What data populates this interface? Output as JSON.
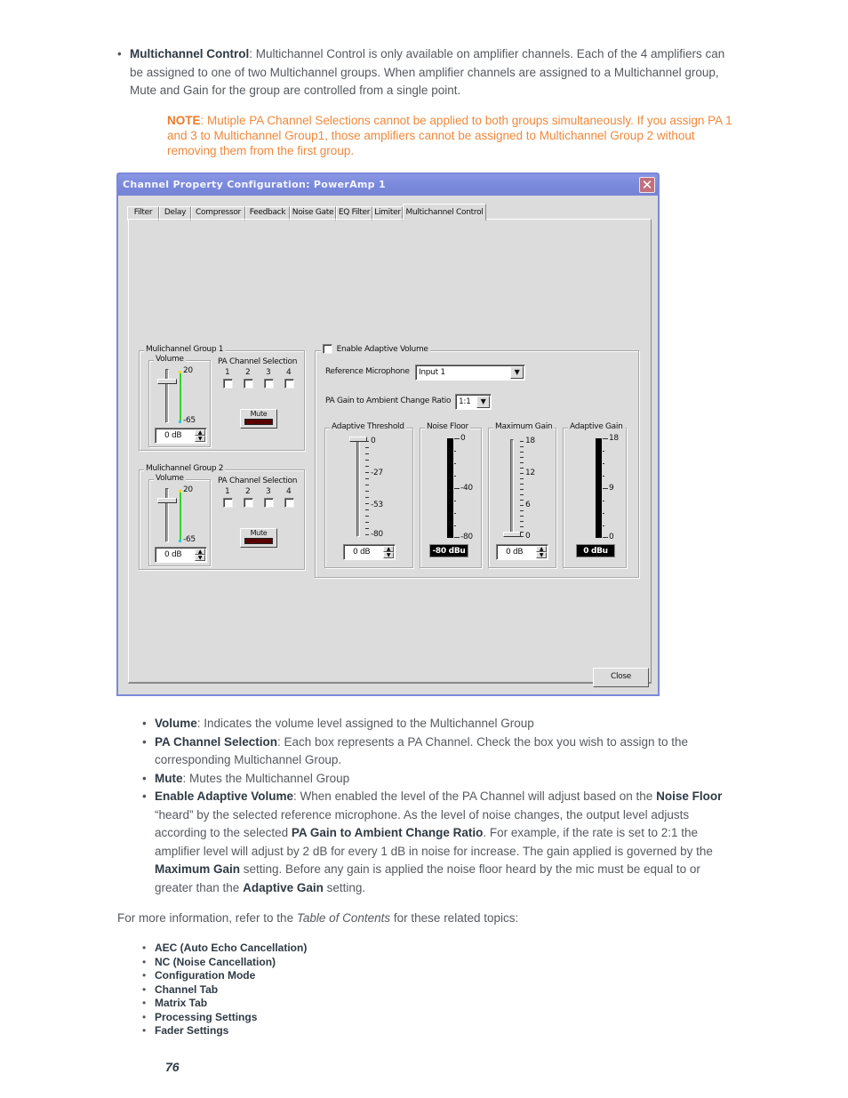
{
  "intro": {
    "term": "Multichannel Control",
    "text": ": Multichannel Control is only available on amplifier channels. Each of the 4 amplifiers can be assigned to one of two Multichannel groups. When amplifier channels are assigned to a Multichannel group, Mute and Gain for the group are controlled from a single point."
  },
  "note": {
    "label": "NOTE",
    "text": ": Mutiple PA Channel Selections cannot be applied to both groups simultaneously. If you assign PA 1 and 3 to Multichannel Group1, those amplifiers cannot be assigned to Multichannel Group 2 without removing them from the first group."
  },
  "dialog": {
    "title": "Channel Property Configuration: PowerAmp 1",
    "close_glyph": "✕",
    "tabs": [
      "Filter",
      "Delay",
      "Compressor",
      "Feedback",
      "Noise Gate",
      "EQ Filter",
      "Limiter",
      "Multichannel Control"
    ],
    "active_tab": "Multichannel Control",
    "groups": [
      {
        "title": "Mulichannel Group 1",
        "volume_label": "Volume",
        "scale_max": "20",
        "scale_min": "-65",
        "volume_value": "0 dB",
        "pa_label": "PA Channel Selection",
        "channels": [
          "1",
          "2",
          "3",
          "4"
        ],
        "checked": [
          false,
          false,
          false,
          false
        ],
        "mute_label": "Mute"
      },
      {
        "title": "Mulichannel Group 2",
        "volume_label": "Volume",
        "scale_max": "20",
        "scale_min": "-65",
        "volume_value": "0 dB",
        "pa_label": "PA Channel Selection",
        "channels": [
          "1",
          "2",
          "3",
          "4"
        ],
        "checked": [
          false,
          false,
          false,
          false
        ],
        "mute_label": "Mute"
      }
    ],
    "adaptive": {
      "enable_label": "Enable Adaptive Volume",
      "enabled": false,
      "ref_mic_label": "Reference Microphone",
      "ref_mic_value": "Input 1",
      "ratio_label": "PA Gain to Ambient Change Ratio",
      "ratio_value": "1:1",
      "threshold": {
        "title": "Adaptive Threshold",
        "ticks": [
          "0",
          "-27",
          "-53",
          "-80"
        ],
        "value": "0 dB"
      },
      "noise_floor": {
        "title": "Noise Floor",
        "ticks": [
          "0",
          "-40",
          "-80"
        ],
        "readout": "-80 dBu"
      },
      "max_gain": {
        "title": "Maximum Gain",
        "ticks": [
          "18",
          "12",
          "6",
          "0"
        ],
        "value": "0 dB"
      },
      "adaptive_gain": {
        "title": "Adaptive Gain",
        "ticks": [
          "18",
          "9",
          "0"
        ],
        "readout": "0 dBu"
      }
    },
    "close_button": "Close"
  },
  "bullets": [
    {
      "term": "Volume",
      "text": ": Indicates the volume level assigned to the Multichannel Group"
    },
    {
      "term": "PA Channel Selection",
      "text": ": Each box represents a PA Channel. Check the box you wish to assign to the corresponding Multichannel Group."
    },
    {
      "term": "Mute",
      "text": ": Mutes the Multichannel Group"
    }
  ],
  "adaptive_bullet": {
    "term": "Enable Adaptive Volume",
    "t1": ": When enabled the level of the PA Channel will adjust based on the ",
    "b1": "Noise Floor",
    "t2": " “heard” by the selected reference microphone. As the level of noise changes, the output level adjusts according to the selected ",
    "b2": "PA Gain to Ambient Change Ratio",
    "t3": ". For example, if the rate is set to 2:1 the amplifier level will adjust by 2 dB for every 1 dB in noise for increase. The gain applied is governed by the ",
    "b3": "Maximum Gain",
    "t4": " setting. Before any gain is applied the noise floor heard by the mic must be equal to or greater than the ",
    "b4": "Adaptive Gain",
    "t5": " setting."
  },
  "more_info": {
    "pre": "For more information, refer to the ",
    "italic": "Table of Contents",
    "post": " for these related topics:"
  },
  "related_topics": [
    "AEC (Auto Echo Cancellation)",
    "NC (Noise Cancellation)",
    "Configuration Mode",
    "Channel Tab",
    "Matrix Tab",
    "Processing Settings",
    "Fader Settings"
  ],
  "page_number": "76"
}
